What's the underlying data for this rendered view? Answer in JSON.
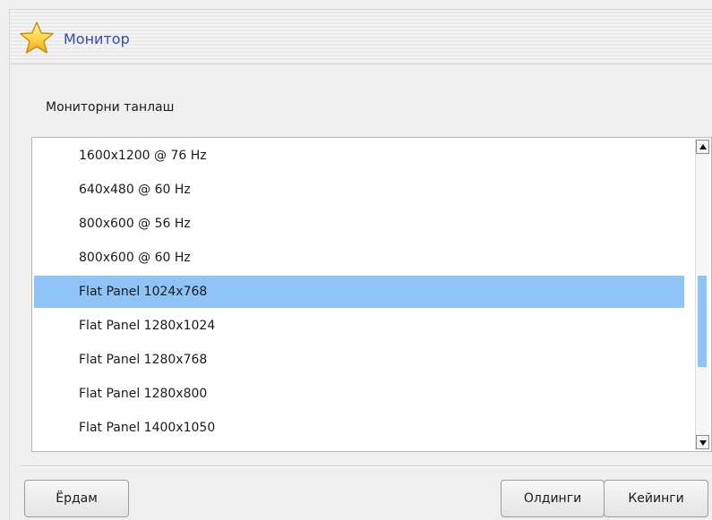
{
  "header": {
    "title": "Монитор",
    "icon": "star-icon",
    "title_color": "#2f4fa8"
  },
  "section": {
    "label": "Мониторни танлаш"
  },
  "monitor_list": {
    "items": [
      "1600x1200 @ 76 Hz",
      "640x480 @ 60 Hz",
      "800x600 @ 56 Hz",
      "800x600 @ 60 Hz",
      "Flat Panel 1024x768",
      "Flat Panel 1280x1024",
      "Flat Panel 1280x768",
      "Flat Panel 1280x800",
      "Flat Panel 1400x1050"
    ],
    "selected": "Flat Panel 1024x768",
    "selection_color": "#8ec3f5"
  },
  "buttons": {
    "help": "Ёрдам",
    "previous": "Олдинги",
    "next": "Кейинги"
  }
}
